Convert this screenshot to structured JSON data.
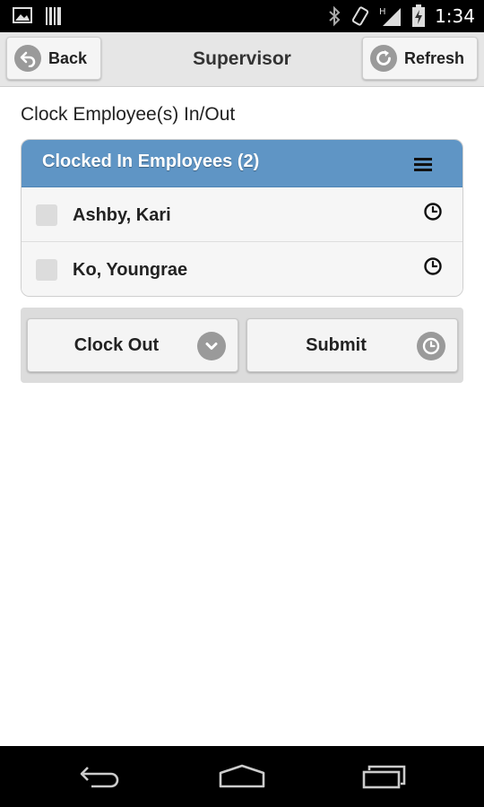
{
  "status_bar": {
    "time": "1:34",
    "icons": [
      "image-icon",
      "barcode-icon",
      "bluetooth-icon",
      "vibrate-icon",
      "signal-icon",
      "battery-charging-icon"
    ]
  },
  "header": {
    "back_label": "Back",
    "title": "Supervisor",
    "refresh_label": "Refresh"
  },
  "page": {
    "heading": "Clock Employee(s) In/Out"
  },
  "panel": {
    "title": "Clocked In Employees (2)",
    "accent_color": "#5f95c5",
    "employees": [
      {
        "name": "Ashby, Kari"
      },
      {
        "name": "Ko, Youngrae"
      }
    ]
  },
  "actions": {
    "select_value": "Clock Out",
    "submit_label": "Submit"
  },
  "nav_bar": {
    "icons": [
      "back-nav-icon",
      "home-nav-icon",
      "recent-apps-icon"
    ]
  }
}
